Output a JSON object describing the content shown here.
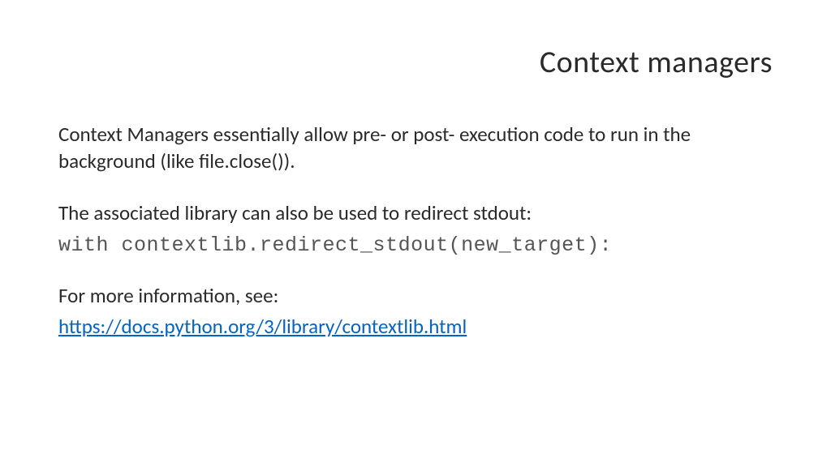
{
  "slide": {
    "title": "Context managers",
    "paragraph1": "Context Managers essentially allow pre- or post- execution code to run in the background (like file.close()).",
    "paragraph2": "The associated library can also be used to redirect stdout:",
    "code_line": "with contextlib.redirect_stdout(new_target):",
    "paragraph3": "For more information, see:",
    "link_text": "https://docs.python.org/3/library/contextlib.html",
    "link_href": "https://docs.python.org/3/library/contextlib.html"
  }
}
